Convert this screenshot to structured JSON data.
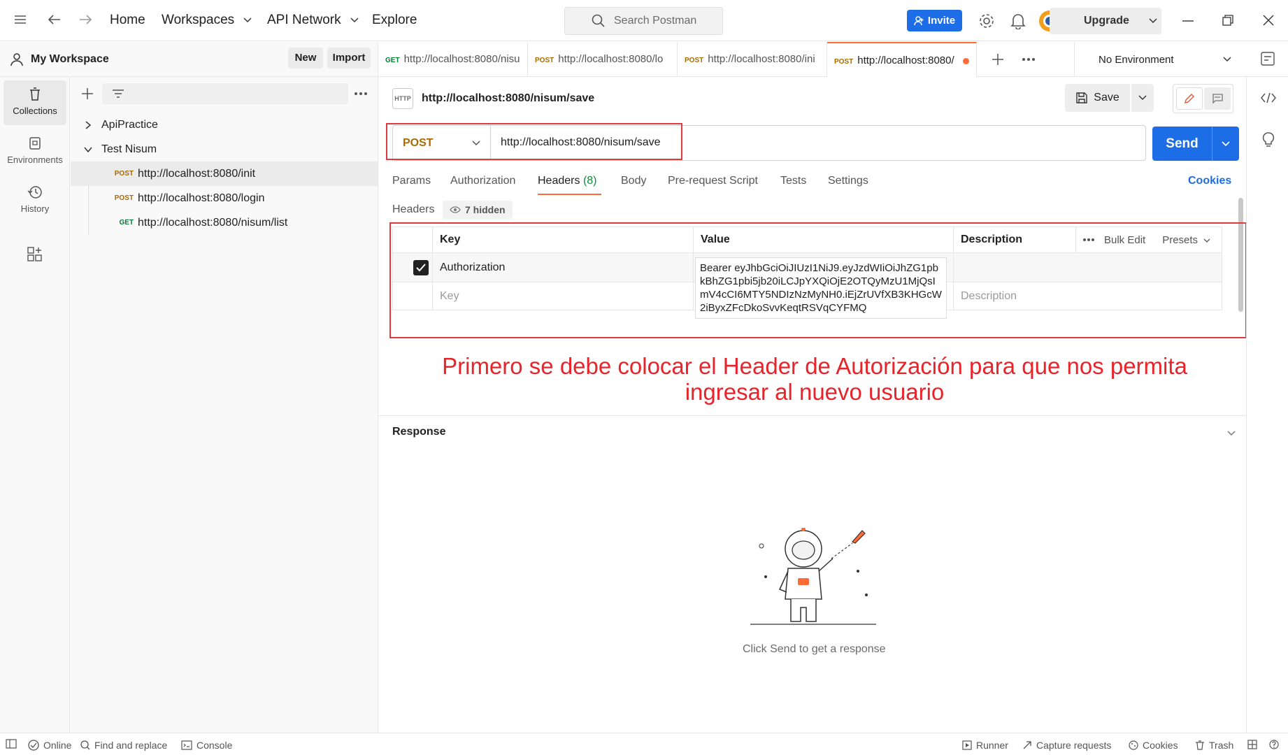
{
  "topbar": {
    "home": "Home",
    "workspaces": "Workspaces",
    "api_network": "API Network",
    "explore": "Explore",
    "search_placeholder": "Search Postman",
    "invite": "Invite",
    "upgrade": "Upgrade"
  },
  "workspace": {
    "name": "My Workspace",
    "new_label": "New",
    "import_label": "Import"
  },
  "rail": [
    {
      "label": "Collections",
      "icon": "trash-can-icon"
    },
    {
      "label": "Environments",
      "icon": "environment-icon"
    },
    {
      "label": "History",
      "icon": "history-icon"
    }
  ],
  "collections": [
    {
      "name": "ApiPractice",
      "expanded": false
    },
    {
      "name": "Test Nisum",
      "expanded": true,
      "requests": [
        {
          "method": "POST",
          "url": "http://localhost:8080/init"
        },
        {
          "method": "POST",
          "url": "http://localhost:8080/login"
        },
        {
          "method": "GET",
          "url": "http://localhost:8080/nisum/list"
        }
      ]
    }
  ],
  "tabs": [
    {
      "method": "GET",
      "url": "http://localhost:8080/nisu"
    },
    {
      "method": "POST",
      "url": "http://localhost:8080/lo"
    },
    {
      "method": "POST",
      "url": "http://localhost:8080/ini"
    },
    {
      "method": "POST",
      "url": "http://localhost:8080/"
    }
  ],
  "environment": "No Environment",
  "request": {
    "title": "http://localhost:8080/nisum/save",
    "method": "POST",
    "url": "http://localhost:8080/nisum/save",
    "save": "Save",
    "send": "Send",
    "tabs": [
      "Params",
      "Authorization",
      "Headers",
      "Body",
      "Pre-request Script",
      "Tests",
      "Settings"
    ],
    "headers_count": "(8)",
    "cookies": "Cookies"
  },
  "headers": {
    "label": "Headers",
    "hidden": "7 hidden",
    "col_key": "Key",
    "col_value": "Value",
    "col_description": "Description",
    "bulk_edit": "Bulk Edit",
    "presets": "Presets",
    "row_key": "Authorization",
    "row_value": "Bearer eyJhbGciOiJIUzI1NiJ9.eyJzdWIiOiJhZG1pbkBhZG1pbi5jb20iLCJpYXQiOjE2OTQyMzU1MjQsImV4cCI6MTY5NDIzNzMyNH0.iEjZrUVfXB3KHGcW2iByxZFcDkoSvvKeqtRSVqCYFMQ",
    "placeholder_key": "Key",
    "placeholder_description": "Description"
  },
  "annotation": {
    "line1": "Primero se debe colocar el Header de Autorización para que nos permita",
    "line2": "ingresar al nuevo usuario"
  },
  "response": {
    "title": "Response",
    "empty": "Click Send to get a response"
  },
  "statusbar": {
    "online": "Online",
    "find": "Find and replace",
    "console": "Console",
    "runner": "Runner",
    "capture": "Capture requests",
    "cookies": "Cookies",
    "trash": "Trash"
  },
  "colors": {
    "accent": "#ff6c37",
    "primary": "#1d6ee6",
    "post": "#a86b00",
    "get": "#007f31",
    "annotation": "#e8242b"
  }
}
